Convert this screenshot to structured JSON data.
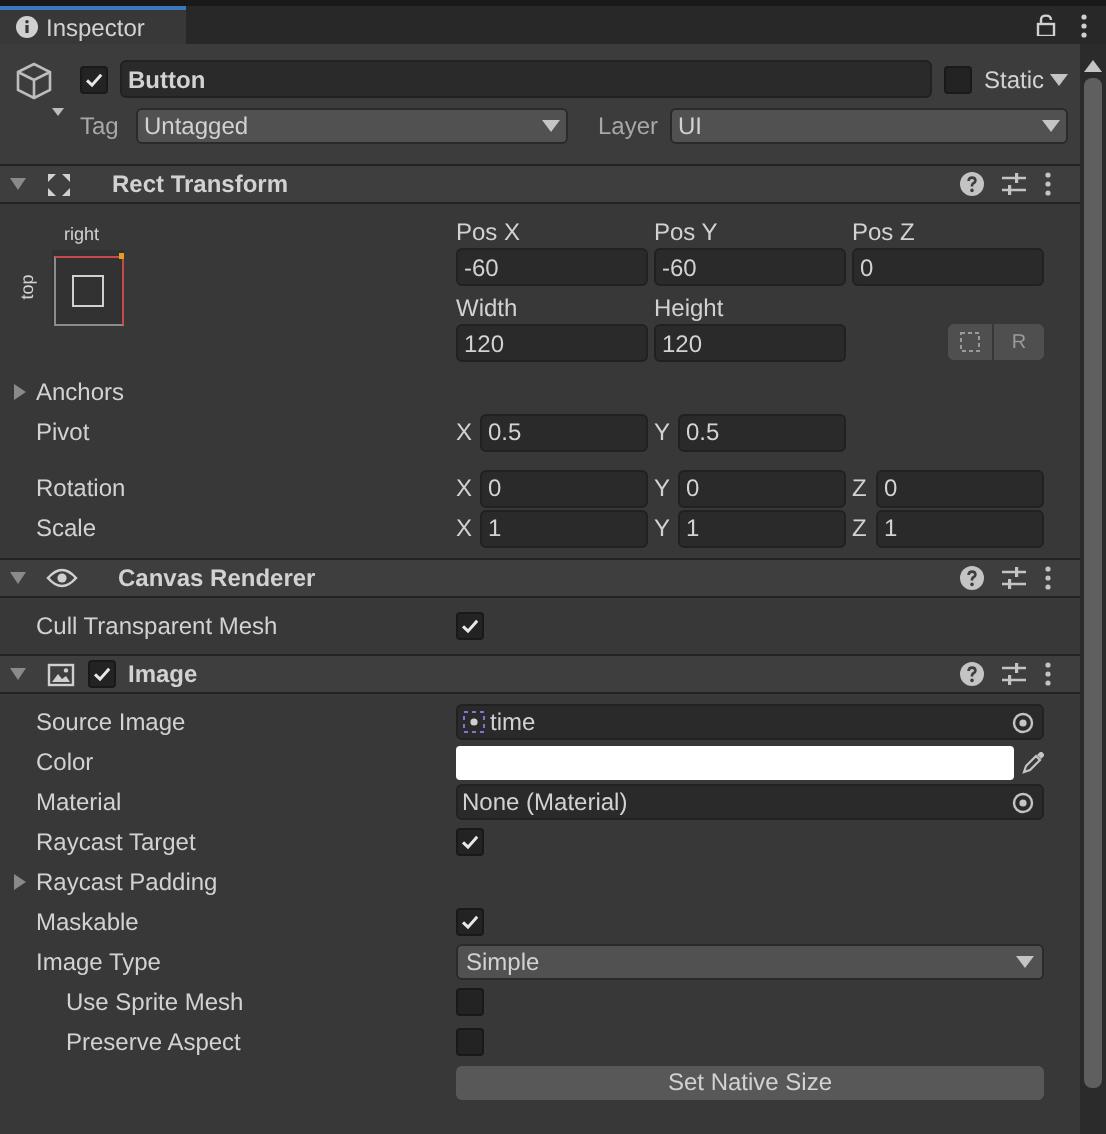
{
  "tab": {
    "title": "Inspector",
    "selected": true
  },
  "object": {
    "active": true,
    "name": "Button",
    "static": false,
    "static_label": "Static",
    "tag_label": "Tag",
    "tag": "Untagged",
    "layer_label": "Layer",
    "layer": "UI"
  },
  "rect_transform": {
    "title": "Rect Transform",
    "expanded": true,
    "anchor_horizontal": "right",
    "anchor_vertical": "top",
    "position": [
      {
        "label": "Pos X",
        "value": "-60"
      },
      {
        "label": "Pos Y",
        "value": "-60"
      },
      {
        "label": "Pos Z",
        "value": "0"
      }
    ],
    "size": [
      {
        "label": "Width",
        "value": "120"
      },
      {
        "label": "Height",
        "value": "120"
      }
    ],
    "raw_button": "R",
    "anchors": {
      "label": "Anchors",
      "expanded": false
    },
    "vectors": [
      {
        "label": "Pivot",
        "fields": [
          {
            "axis": "X",
            "value": "0.5"
          },
          {
            "axis": "Y",
            "value": "0.5"
          }
        ]
      },
      {
        "label": "Rotation",
        "fields": [
          {
            "axis": "X",
            "value": "0"
          },
          {
            "axis": "Y",
            "value": "0"
          },
          {
            "axis": "Z",
            "value": "0"
          }
        ]
      },
      {
        "label": "Scale",
        "fields": [
          {
            "axis": "X",
            "value": "1"
          },
          {
            "axis": "Y",
            "value": "1"
          },
          {
            "axis": "Z",
            "value": "1"
          }
        ]
      }
    ]
  },
  "components": [
    {
      "title": "Canvas Renderer",
      "kind": "eye",
      "expanded": true,
      "rows": [
        {
          "kind": "checkbox",
          "label": "Cull Transparent Mesh",
          "checked": true
        }
      ]
    },
    {
      "title": "Image",
      "kind": "image",
      "expanded": true,
      "enabled": true,
      "rows": [
        {
          "kind": "object",
          "label": "Source Image",
          "value": "time",
          "asset_icon": true
        },
        {
          "kind": "color",
          "label": "Color",
          "color": "#ffffff"
        },
        {
          "kind": "object",
          "label": "Material",
          "value": "None (Material)",
          "asset_icon": false
        },
        {
          "kind": "checkbox",
          "label": "Raycast Target",
          "checked": true
        },
        {
          "kind": "foldout",
          "label": "Raycast Padding",
          "expanded": false
        },
        {
          "kind": "checkbox",
          "label": "Maskable",
          "checked": true
        },
        {
          "kind": "dropdown",
          "label": "Image Type",
          "value": "Simple",
          "children": [
            {
              "kind": "checkbox",
              "label": "Use Sprite Mesh",
              "checked": false
            },
            {
              "kind": "checkbox",
              "label": "Preserve Aspect",
              "checked": false
            }
          ]
        },
        {
          "kind": "button",
          "label": "Set Native Size"
        }
      ]
    }
  ]
}
